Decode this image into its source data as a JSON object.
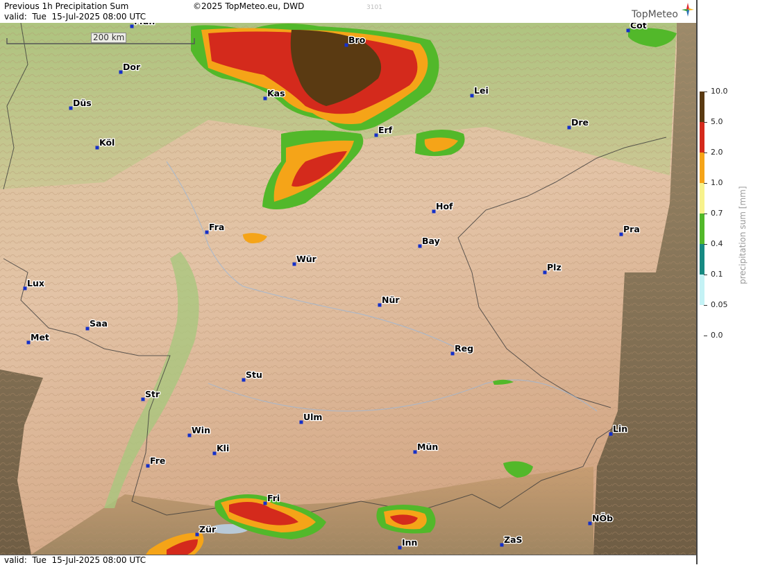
{
  "header": {
    "title": "Previous 1h Precipitation Sum",
    "valid": "valid:  Tue  15-Jul-2025 08:00 UTC",
    "copyright": "©2025 TopMeteo.eu, DWD",
    "code": "3101",
    "logo": "TopMeteo"
  },
  "footer": {
    "valid": "valid:  Tue  15-Jul-2025 08:00 UTC"
  },
  "scale_bar": {
    "label": "200 km"
  },
  "legend": {
    "title": "precipitation sum [mm]",
    "classes": [
      {
        "label": "10.0",
        "color": "#5a3a12"
      },
      {
        "label": "5.0",
        "color": "#d42a1c"
      },
      {
        "label": "2.0",
        "color": "#f5a418"
      },
      {
        "label": "1.0",
        "color": "#f7f28c"
      },
      {
        "label": "0.7",
        "color": "#52b82a"
      },
      {
        "label": "0.4",
        "color": "#178a82"
      },
      {
        "label": "0.1",
        "color": "#c4f2f5"
      },
      {
        "label": "0.05",
        "color": "#ffffff"
      },
      {
        "label": "0.0",
        "color": "#ffffff"
      }
    ]
  },
  "cities": [
    {
      "name": "Mün",
      "id": "mun-top"
    },
    {
      "name": "Bro"
    },
    {
      "name": "Cot"
    },
    {
      "name": "Dor"
    },
    {
      "name": "Kas"
    },
    {
      "name": "Lei"
    },
    {
      "name": "Düs"
    },
    {
      "name": "Dre"
    },
    {
      "name": "Erf"
    },
    {
      "name": "Köl"
    },
    {
      "name": "Hof"
    },
    {
      "name": "Fra"
    },
    {
      "name": "Pra"
    },
    {
      "name": "Bay"
    },
    {
      "name": "Wür"
    },
    {
      "name": "Plz"
    },
    {
      "name": "Lux"
    },
    {
      "name": "Nür"
    },
    {
      "name": "Saa"
    },
    {
      "name": "Met"
    },
    {
      "name": "Reg"
    },
    {
      "name": "Stu"
    },
    {
      "name": "Str"
    },
    {
      "name": "Ulm"
    },
    {
      "name": "Win"
    },
    {
      "name": "Lin"
    },
    {
      "name": "Kli"
    },
    {
      "name": "Mün"
    },
    {
      "name": "Fre"
    },
    {
      "name": "Fri"
    },
    {
      "name": "NÖb"
    },
    {
      "name": "Zür"
    },
    {
      "name": "Inn"
    },
    {
      "name": "ZaS"
    }
  ]
}
